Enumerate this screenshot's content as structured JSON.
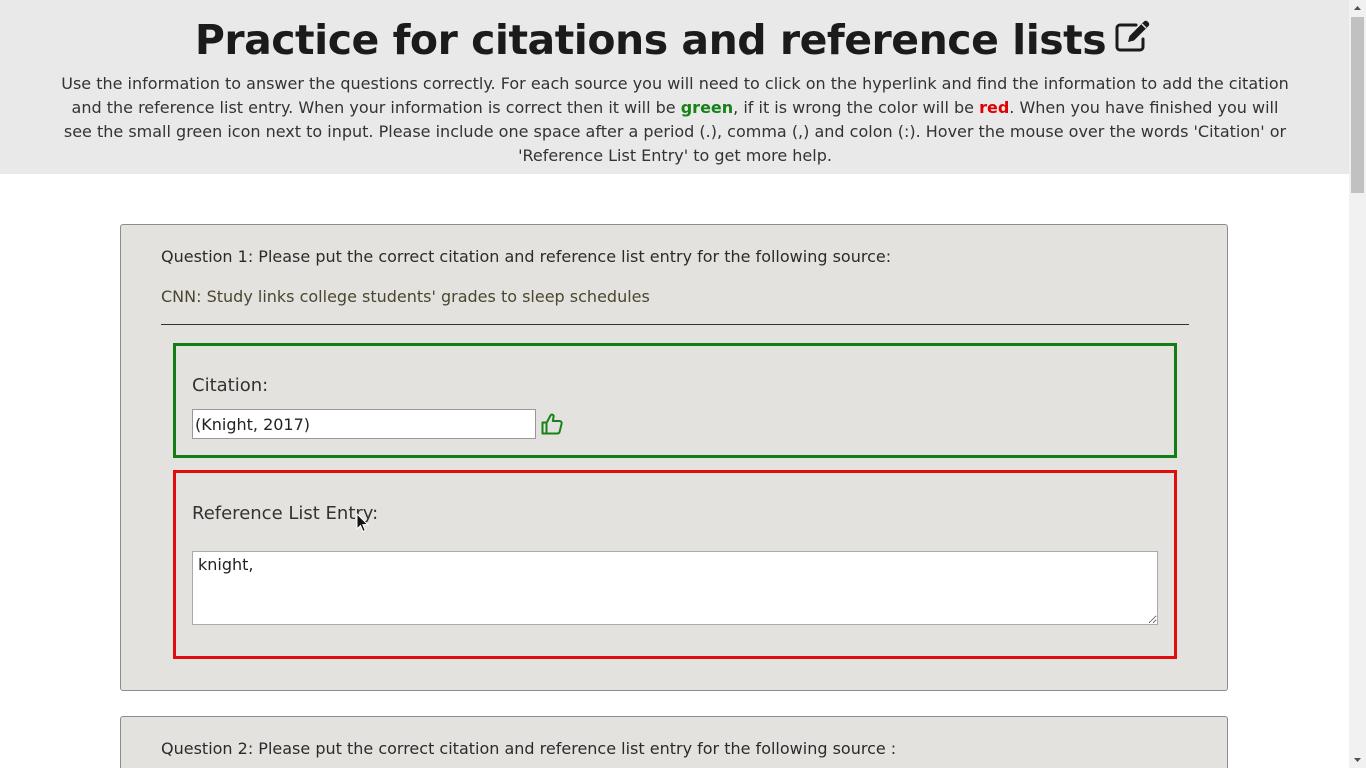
{
  "header": {
    "title": "Practice for citations and reference lists",
    "title_icon": "edit-icon",
    "intro": {
      "part1": "Use the information to answer the questions correctly. For each source you will need to click on the hyperlink and find the information to add the citation and the reference list entry. When your information is correct then it will be ",
      "green_word": "green",
      "part2": ", if it is wrong the color will be ",
      "red_word": "red",
      "part3": ". When you have finished you will see the small green icon next to input. Please include one space after a period (.), comma (,) and colon (:). Hover the mouse over the words 'Citation' or 'Reference List Entry' to get more help."
    }
  },
  "question1": {
    "prompt": "Question 1: Please put the correct citation and reference list entry for the following source:",
    "source_link": "CNN: Study links college students' grades to sleep schedules",
    "citation": {
      "label": "Citation:",
      "value": "(Knight, 2017)",
      "status": "correct",
      "status_icon": "thumbs-up-icon",
      "border_color": "#137c13"
    },
    "reference": {
      "label": "Reference List Entry:",
      "value": "knight,",
      "status": "incorrect",
      "border_color": "#e00d0d"
    }
  },
  "question2": {
    "prompt": "Question 2: Please put the correct citation and reference list entry for the following source :"
  },
  "colors": {
    "header_bg": "#e9e9e9",
    "panel_bg": "#e4e2df",
    "green_text": "#178217",
    "red_text": "#e00000"
  }
}
